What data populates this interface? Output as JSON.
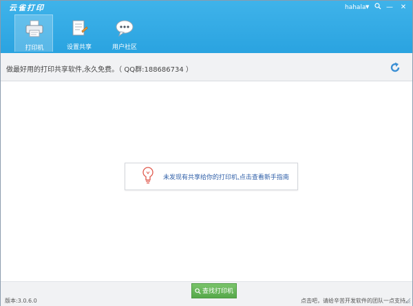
{
  "app": {
    "logo_text": "云雀打印"
  },
  "titlebar": {
    "user_name": "hahala",
    "user_caret": "▼",
    "minimize": "—",
    "close": "✕"
  },
  "toolbar": {
    "items": [
      {
        "label": "打印机",
        "icon": "printer-icon",
        "active": true
      },
      {
        "label": "设置共享",
        "icon": "document-share-icon",
        "active": false
      },
      {
        "label": "用户社区",
        "icon": "chat-bubble-icon",
        "active": false
      }
    ]
  },
  "info": {
    "text": "做最好用的打印共享软件,永久免费。（ QQ群:188686734 ）"
  },
  "notice": {
    "text": "未发现有共享给你的打印机,点击查看新手指南"
  },
  "bottom": {
    "version": "版本:3.0.6.0",
    "find_button": "查找打印机",
    "footer_note": "点击吧，请给辛苦开发软件的团队一点支持。"
  },
  "colors": {
    "titlebar": "#2aa3e0",
    "find_button": "#56a84a",
    "notice_text": "#2f5fa8"
  }
}
